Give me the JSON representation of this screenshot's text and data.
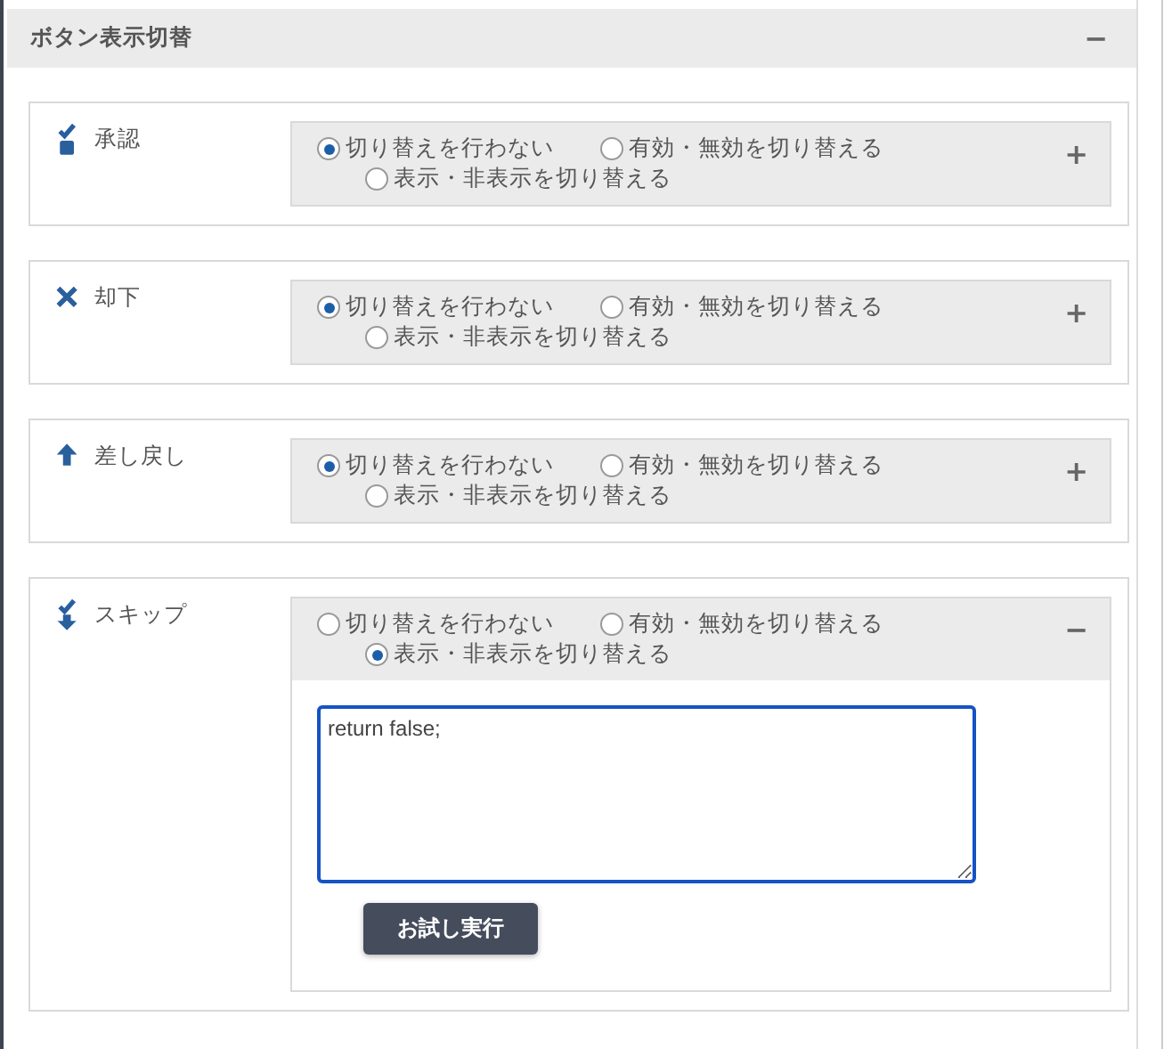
{
  "panel": {
    "title": "ボタン表示切替",
    "toggle": "−"
  },
  "buttons": [
    {
      "kind": "approve",
      "name": "承認",
      "expanded": false,
      "toggle": "+",
      "options": [
        {
          "label": "切り替えを行わない",
          "selected": true
        },
        {
          "label": "有効・無効を切り替える",
          "selected": false
        },
        {
          "label": "表示・非表示を切り替える",
          "selected": false
        }
      ]
    },
    {
      "kind": "reject",
      "name": "却下",
      "expanded": false,
      "toggle": "+",
      "options": [
        {
          "label": "切り替えを行わない",
          "selected": true
        },
        {
          "label": "有効・無効を切り替える",
          "selected": false
        },
        {
          "label": "表示・非表示を切り替える",
          "selected": false
        }
      ]
    },
    {
      "kind": "sendback",
      "name": "差し戻し",
      "expanded": false,
      "toggle": "+",
      "options": [
        {
          "label": "切り替えを行わない",
          "selected": true
        },
        {
          "label": "有効・無効を切り替える",
          "selected": false
        },
        {
          "label": "表示・非表示を切り替える",
          "selected": false
        }
      ]
    },
    {
      "kind": "skip",
      "name": "スキップ",
      "expanded": true,
      "toggle": "−",
      "options": [
        {
          "label": "切り替えを行わない",
          "selected": false
        },
        {
          "label": "有効・無効を切り替える",
          "selected": false
        },
        {
          "label": "表示・非表示を切り替える",
          "selected": true
        }
      ],
      "script": "return false;",
      "run_button": "お試し実行"
    }
  ]
}
